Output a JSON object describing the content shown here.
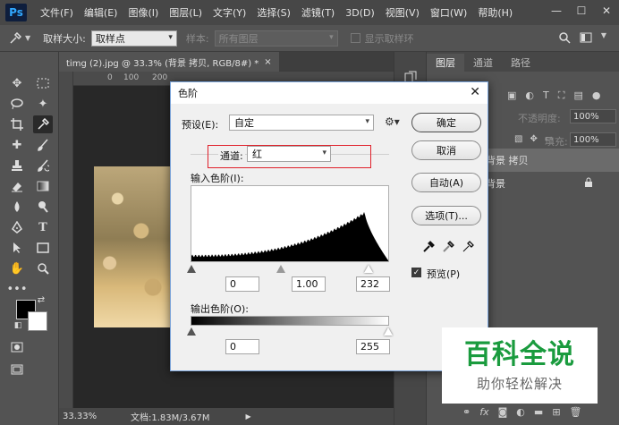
{
  "app": {
    "logo": "Ps"
  },
  "menu": [
    "文件(F)",
    "编辑(E)",
    "图像(I)",
    "图层(L)",
    "文字(Y)",
    "选择(S)",
    "滤镜(T)",
    "3D(D)",
    "视图(V)",
    "窗口(W)",
    "帮助(H)"
  ],
  "window_controls": {
    "minimize": "—",
    "maximize": "☐",
    "close": "✕"
  },
  "options": {
    "sample_size_label": "取样大小:",
    "sample_size_value": "取样点",
    "sample_label": "样本:",
    "sample_value": "所有图层",
    "show_ring_label": "显示取样环"
  },
  "document": {
    "tab_title": "timg (2).jpg @ 33.3% (背景 拷贝, RGB/8#) *",
    "tab_close": "×",
    "ruler_ticks": [
      "0",
      "100",
      "200"
    ],
    "zoom": "33.33%",
    "info": "文档:1.83M/3.67M",
    "status_arrow": "▶"
  },
  "layers_panel": {
    "tabs": [
      "图层",
      "通道",
      "路径"
    ],
    "opacity_label": "不透明度:",
    "opacity_value": "100%",
    "fill_label": "填充:",
    "fill_value": "100%",
    "layers": [
      {
        "name": "背景 拷贝",
        "selected": true
      },
      {
        "name": "背景",
        "locked": true
      }
    ],
    "footer_icons": [
      "link-icon",
      "fx-icon",
      "mask-icon",
      "adjustment-icon",
      "folder-icon",
      "new-layer-icon",
      "trash-icon"
    ]
  },
  "levels_dialog": {
    "title": "色阶",
    "close": "✕",
    "preset_label": "预设(E):",
    "preset_value": "自定",
    "channel_label": "通道:",
    "channel_value": "红",
    "input_levels_label": "输入色阶(I):",
    "input_black": "0",
    "input_gamma": "1.00",
    "input_white": "232",
    "input_white_pos": 0.909,
    "output_levels_label": "输出色阶(O):",
    "output_black": "0",
    "output_white": "255",
    "buttons": {
      "ok": "确定",
      "cancel": "取消",
      "auto": "自动(A)",
      "options": "选项(T)..."
    },
    "preview_label": "预览(P)",
    "preview_checked": true,
    "highlight_color": "#e0202a"
  },
  "watermark": {
    "title": "百科全说",
    "subtitle": "助你轻松解决",
    "color": "#1a9b3e"
  }
}
